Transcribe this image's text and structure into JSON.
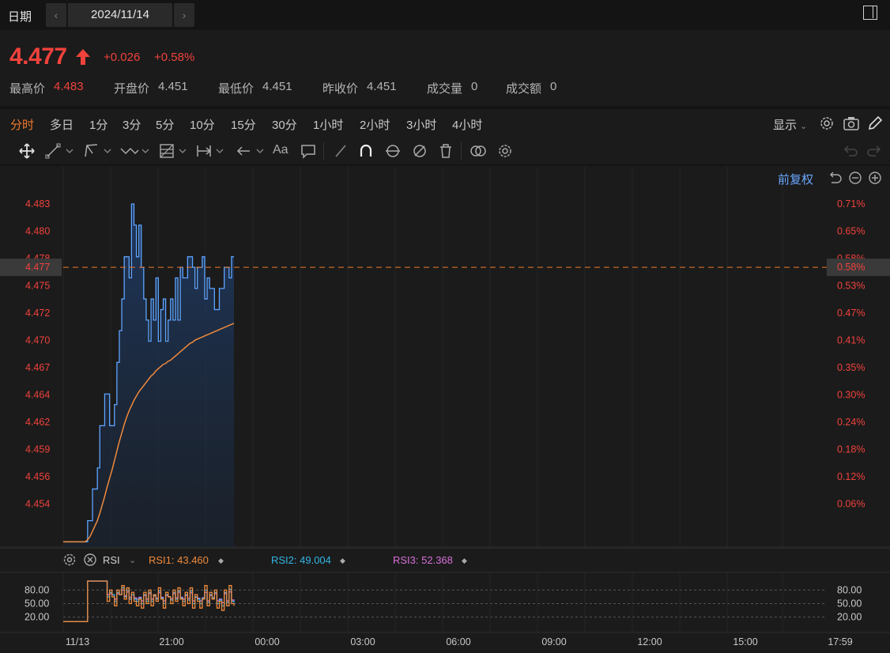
{
  "header": {
    "date_label": "日期",
    "date_value": "2024/11/14",
    "prev_icon": "‹",
    "next_icon": "›"
  },
  "quote": {
    "price": "4.477",
    "change": "+0.026",
    "change_pct": "+0.58%",
    "stats": [
      {
        "label": "最高价",
        "value": "4.483",
        "red": true
      },
      {
        "label": "开盘价",
        "value": "4.451",
        "red": false
      },
      {
        "label": "最低价",
        "value": "4.451",
        "red": false
      },
      {
        "label": "昨收价",
        "value": "4.451",
        "red": false
      },
      {
        "label": "成交量",
        "value": "0",
        "red": false
      },
      {
        "label": "成交额",
        "value": "0",
        "red": false
      }
    ]
  },
  "periods": [
    "分时",
    "多日",
    "1分",
    "3分",
    "5分",
    "10分",
    "15分",
    "30分",
    "1小时",
    "2小时",
    "3小时",
    "4小时"
  ],
  "active_period": "分时",
  "display_label": "显示",
  "adjust_label": "前复权",
  "chart_data": {
    "type": "line",
    "y_left_ticks": [
      "4.483",
      "4.480",
      "4.478",
      "4.475",
      "4.472",
      "4.470",
      "4.467",
      "4.464",
      "4.462",
      "4.459",
      "4.456",
      "4.454"
    ],
    "y_right_ticks": [
      "0.71%",
      "0.65%",
      "0.58%",
      "0.53%",
      "0.47%",
      "0.41%",
      "0.35%",
      "0.30%",
      "0.24%",
      "0.18%",
      "0.12%",
      "0.06%"
    ],
    "current_price_label": "4.477",
    "current_pct_label": "0.58%",
    "x_labels": [
      "11/13",
      "21:00",
      "00:00",
      "03:00",
      "06:00",
      "09:00",
      "12:00",
      "15:00",
      "17:59"
    ],
    "ylim": [
      4.4505,
      4.4845
    ],
    "price_series": {
      "name": "价格",
      "color": "#5ea4ff",
      "values": [
        4.451,
        4.451,
        4.451,
        4.451,
        4.451,
        4.451,
        4.451,
        4.451,
        4.451,
        4.451,
        4.453,
        4.453,
        4.456,
        4.456,
        4.458,
        4.462,
        4.462,
        4.465,
        4.465,
        4.462,
        4.462,
        4.464,
        4.468,
        4.471,
        4.474,
        4.478,
        4.478,
        4.476,
        4.483,
        4.481,
        4.478,
        4.481,
        4.477,
        4.474,
        4.472,
        4.47,
        4.474,
        4.472,
        4.476,
        4.47,
        4.473,
        4.474,
        4.47,
        4.472,
        4.474,
        4.472,
        4.476,
        4.472,
        4.477,
        4.476,
        4.476,
        4.478,
        4.478,
        4.477,
        4.475,
        4.477,
        4.477,
        4.478,
        4.474,
        4.476,
        4.475,
        4.475,
        4.473,
        4.473,
        4.475,
        4.475,
        4.477,
        4.477,
        4.476,
        4.478,
        4.478
      ]
    },
    "avg_series": {
      "name": "均价",
      "color": "#f08a3c",
      "values": [
        4.451,
        4.451,
        4.451,
        4.451,
        4.451,
        4.451,
        4.451,
        4.451,
        4.451,
        4.451,
        4.4512,
        4.4515,
        4.452,
        4.4525,
        4.453,
        4.4537,
        4.4545,
        4.4553,
        4.4562,
        4.457,
        4.4578,
        4.4587,
        4.4596,
        4.4605,
        4.4613,
        4.4621,
        4.4628,
        4.4634,
        4.4639,
        4.4644,
        4.4648,
        4.4652,
        4.4655,
        4.4658,
        4.4661,
        4.4664,
        4.4667,
        4.4669,
        4.4672,
        4.4674,
        4.4676,
        4.4678,
        4.4679,
        4.4681,
        4.4682,
        4.4684,
        4.4686,
        4.4688,
        4.469,
        4.4692,
        4.4694,
        4.4696,
        4.4698,
        4.4699,
        4.4701,
        4.4702,
        4.4703,
        4.4704,
        4.4705,
        4.4706,
        4.4707,
        4.4708,
        4.4709,
        4.471,
        4.4711,
        4.4712,
        4.4713,
        4.4714,
        4.4715,
        4.4716,
        4.4717
      ]
    }
  },
  "rsi": {
    "title": "RSI",
    "rsi1": "RSI1: 43.460",
    "rsi2": "RSI2: 49.004",
    "rsi3": "RSI3: 52.368",
    "rsi1_color": "#f08a3c",
    "rsi2_color": "#33b5e5",
    "rsi3_color": "#d86fd8",
    "ticks": [
      "80.00",
      "50.00",
      "20.00"
    ],
    "ylim": [
      0,
      100
    ],
    "rsi1_values": [
      10,
      10,
      10,
      10,
      10,
      10,
      10,
      10,
      10,
      10,
      100,
      100,
      100,
      100,
      100,
      100,
      100,
      100,
      55,
      80,
      65,
      45,
      80,
      70,
      90,
      60,
      85,
      50,
      75,
      55,
      45,
      60,
      40,
      75,
      50,
      80,
      45,
      70,
      55,
      85,
      60,
      40,
      75,
      65,
      50,
      80,
      55,
      85,
      60,
      45,
      75,
      50,
      85,
      40,
      70,
      55,
      40,
      60,
      90,
      45,
      75,
      60,
      80,
      40,
      55,
      35,
      80,
      45,
      90,
      50,
      45
    ],
    "rsi2_values": [
      10,
      10,
      10,
      10,
      10,
      10,
      10,
      10,
      10,
      10,
      100,
      100,
      100,
      100,
      100,
      100,
      100,
      100,
      65,
      75,
      70,
      55,
      75,
      70,
      85,
      65,
      80,
      60,
      70,
      60,
      55,
      62,
      50,
      70,
      55,
      75,
      55,
      68,
      60,
      78,
      62,
      50,
      70,
      65,
      58,
      75,
      60,
      78,
      62,
      55,
      70,
      58,
      78,
      50,
      65,
      60,
      50,
      62,
      80,
      52,
      70,
      62,
      75,
      50,
      58,
      45,
      75,
      52,
      82,
      55,
      52
    ],
    "rsi3_values": [
      10,
      10,
      10,
      10,
      10,
      10,
      10,
      10,
      10,
      10,
      100,
      100,
      100,
      100,
      100,
      100,
      100,
      100,
      70,
      72,
      70,
      60,
      72,
      70,
      80,
      67,
      76,
      64,
      70,
      63,
      60,
      64,
      56,
      68,
      60,
      72,
      60,
      67,
      62,
      74,
      64,
      56,
      68,
      65,
      61,
      72,
      63,
      75,
      64,
      60,
      68,
      62,
      74,
      56,
      64,
      62,
      56,
      63,
      75,
      56,
      68,
      63,
      72,
      56,
      60,
      52,
      72,
      56,
      76,
      58,
      56
    ]
  }
}
